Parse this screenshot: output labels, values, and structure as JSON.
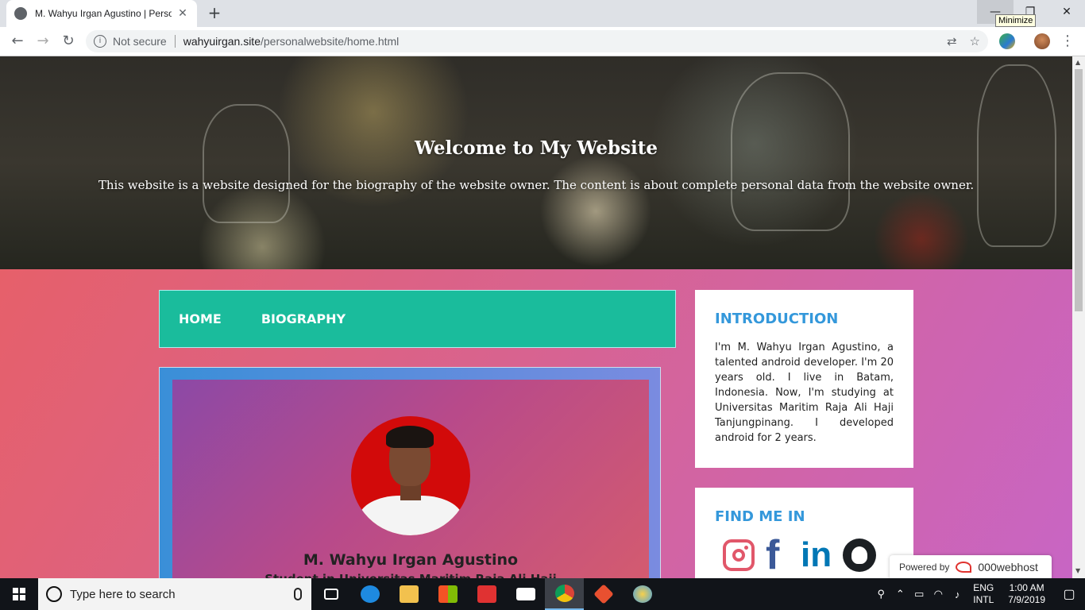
{
  "browser": {
    "tab_title": "M. Wahyu Irgan Agustino | Personal Website",
    "new_tab": "+",
    "tooltip": "Minimize",
    "security": "Not secure",
    "url_host": "wahyuirgan.site",
    "url_path": "/personalwebsite/home.html"
  },
  "hero": {
    "title": "Welcome to My Website",
    "subtitle": "This website is a website designed for the biography of the website owner. The content is about complete personal data from the website owner."
  },
  "nav": {
    "items": [
      {
        "label": "HOME"
      },
      {
        "label": "BIOGRAPHY"
      }
    ]
  },
  "profile": {
    "name": "M. Wahyu Irgan Agustino",
    "subtitle": "Student in Universitas Maritim Raja Ali Haji"
  },
  "introduction": {
    "heading": "INTRODUCTION",
    "text": "I'm M. Wahyu Irgan Agustino, a talented android developer. I'm 20 years old. I live in Batam, Indonesia. Now, I'm studying at Universitas Maritim Raja Ali Haji Tanjungpinang. I developed android for 2 years."
  },
  "find_me": {
    "heading": "FIND ME IN",
    "facebook_glyph": "f",
    "linkedin_glyph": "in"
  },
  "powered": {
    "label": "Powered by",
    "brand": "000webhost"
  },
  "taskbar": {
    "search_placeholder": "Type here to search",
    "lang_1": "ENG",
    "lang_2": "INTL",
    "time": "1:00 AM",
    "date": "7/9/2019"
  },
  "colors": {
    "nav_bg": "#1abc9c",
    "heading_blue": "#3498db",
    "instagram": "#e1576a",
    "facebook": "#3b5998",
    "linkedin": "#0077b5"
  }
}
